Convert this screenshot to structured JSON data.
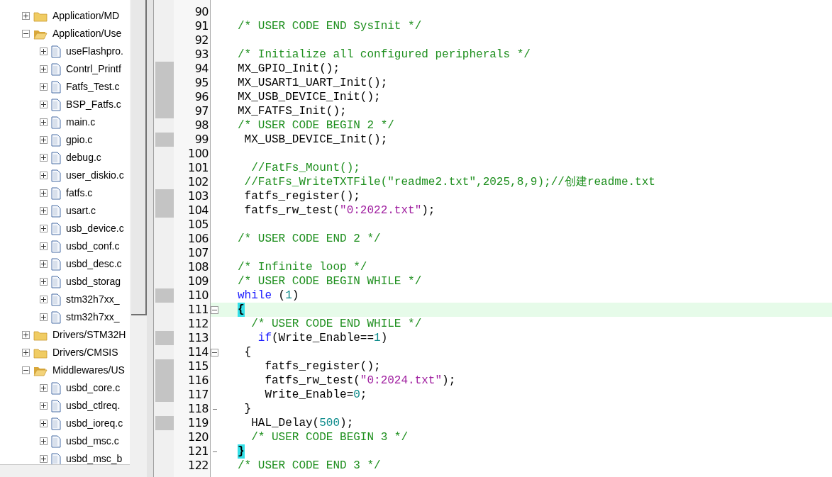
{
  "project_tree": [
    {
      "kind": "folder",
      "label": "Application/MD",
      "expanded": false
    },
    {
      "kind": "folder",
      "label": "Application/Use",
      "expanded": true,
      "children": [
        {
          "kind": "file",
          "label": "useFlashpro."
        },
        {
          "kind": "file",
          "label": "Contrl_Printf"
        },
        {
          "kind": "file",
          "label": "Fatfs_Test.c"
        },
        {
          "kind": "file",
          "label": "BSP_Fatfs.c"
        },
        {
          "kind": "file",
          "label": "main.c"
        },
        {
          "kind": "file",
          "label": "gpio.c"
        },
        {
          "kind": "file",
          "label": "debug.c"
        },
        {
          "kind": "file",
          "label": "user_diskio.c"
        },
        {
          "kind": "file",
          "label": "fatfs.c"
        },
        {
          "kind": "file",
          "label": "usart.c"
        },
        {
          "kind": "file",
          "label": "usb_device.c"
        },
        {
          "kind": "file",
          "label": "usbd_conf.c"
        },
        {
          "kind": "file",
          "label": "usbd_desc.c"
        },
        {
          "kind": "file",
          "label": "usbd_storag"
        },
        {
          "kind": "file",
          "label": "stm32h7xx_"
        },
        {
          "kind": "file",
          "label": "stm32h7xx_"
        }
      ]
    },
    {
      "kind": "folder",
      "label": "Drivers/STM32H",
      "expanded": false
    },
    {
      "kind": "folder",
      "label": "Drivers/CMSIS",
      "expanded": false
    },
    {
      "kind": "folder",
      "label": "Middlewares/US",
      "expanded": true,
      "children": [
        {
          "kind": "file",
          "label": "usbd_core.c"
        },
        {
          "kind": "file",
          "label": "usbd_ctlreq."
        },
        {
          "kind": "file",
          "label": "usbd_ioreq.c"
        },
        {
          "kind": "file",
          "label": "usbd_msc.c"
        },
        {
          "kind": "file",
          "label": "usbd_msc_b"
        }
      ]
    }
  ],
  "editor": {
    "lines": [
      {
        "number": "90",
        "marked": false,
        "current": false,
        "fold_open": false,
        "fold_end": false
      },
      {
        "number": "91",
        "marked": false,
        "current": false,
        "fold_open": false,
        "fold_end": false,
        "segments": [
          {
            "kind": "comment",
            "text": "/* USER CODE END SysInit */"
          }
        ]
      },
      {
        "number": "92",
        "marked": false,
        "current": false,
        "fold_open": false,
        "fold_end": false
      },
      {
        "number": "93",
        "marked": false,
        "current": false,
        "fold_open": false,
        "fold_end": false,
        "segments": [
          {
            "kind": "comment",
            "text": "/* Initialize all configured peripherals */"
          }
        ]
      },
      {
        "number": "94",
        "marked": true,
        "current": false,
        "fold_open": false,
        "fold_end": false,
        "segments": [
          {
            "kind": "plain",
            "text": "MX_GPIO_Init();"
          }
        ]
      },
      {
        "number": "95",
        "marked": true,
        "current": false,
        "fold_open": false,
        "fold_end": false,
        "segments": [
          {
            "kind": "plain",
            "text": "MX_USART1_UART_Init();"
          }
        ]
      },
      {
        "number": "96",
        "marked": true,
        "current": false,
        "fold_open": false,
        "fold_end": false,
        "segments": [
          {
            "kind": "plain",
            "text": "MX_USB_DEVICE_Init();"
          }
        ]
      },
      {
        "number": "97",
        "marked": true,
        "current": false,
        "fold_open": false,
        "fold_end": false,
        "segments": [
          {
            "kind": "plain",
            "text": "MX_FATFS_Init();"
          }
        ]
      },
      {
        "number": "98",
        "marked": false,
        "current": false,
        "fold_open": false,
        "fold_end": false,
        "segments": [
          {
            "kind": "comment",
            "text": "/* USER CODE BEGIN 2 */"
          }
        ]
      },
      {
        "number": "99",
        "marked": true,
        "current": false,
        "fold_open": false,
        "fold_end": false,
        "segments": [
          {
            "kind": "plain",
            "text": " MX_USB_DEVICE_Init();"
          }
        ]
      },
      {
        "number": "100",
        "marked": false,
        "current": false,
        "fold_open": false,
        "fold_end": false
      },
      {
        "number": "101",
        "marked": false,
        "current": false,
        "fold_open": false,
        "fold_end": false,
        "segments": [
          {
            "kind": "comment",
            "text": "  //FatFs_Mount();"
          }
        ]
      },
      {
        "number": "102",
        "marked": false,
        "current": false,
        "fold_open": false,
        "fold_end": false,
        "segments": [
          {
            "kind": "comment",
            "text": " //FatFs_WriteTXTFile(\"readme2.txt\",2025,8,9);//创建readme.txt"
          }
        ]
      },
      {
        "number": "103",
        "marked": true,
        "current": false,
        "fold_open": false,
        "fold_end": false,
        "segments": [
          {
            "kind": "plain",
            "text": " fatfs_register();"
          }
        ]
      },
      {
        "number": "104",
        "marked": true,
        "current": false,
        "fold_open": false,
        "fold_end": false,
        "segments": [
          {
            "kind": "plain",
            "text": " fatfs_rw_test("
          },
          {
            "kind": "string",
            "text": "\"0:2022.txt\""
          },
          {
            "kind": "plain",
            "text": ");"
          }
        ]
      },
      {
        "number": "105",
        "marked": false,
        "current": false,
        "fold_open": false,
        "fold_end": false
      },
      {
        "number": "106",
        "marked": false,
        "current": false,
        "fold_open": false,
        "fold_end": false,
        "segments": [
          {
            "kind": "comment",
            "text": "/* USER CODE END 2 */"
          }
        ]
      },
      {
        "number": "107",
        "marked": false,
        "current": false,
        "fold_open": false,
        "fold_end": false
      },
      {
        "number": "108",
        "marked": false,
        "current": false,
        "fold_open": false,
        "fold_end": false,
        "segments": [
          {
            "kind": "comment",
            "text": "/* Infinite loop */"
          }
        ]
      },
      {
        "number": "109",
        "marked": false,
        "current": false,
        "fold_open": false,
        "fold_end": false,
        "segments": [
          {
            "kind": "comment",
            "text": "/* USER CODE BEGIN WHILE */"
          }
        ]
      },
      {
        "number": "110",
        "marked": true,
        "current": false,
        "fold_open": false,
        "fold_end": false,
        "segments": [
          {
            "kind": "keyword",
            "text": "while"
          },
          {
            "kind": "plain",
            "text": " ("
          },
          {
            "kind": "number",
            "text": "1"
          },
          {
            "kind": "plain",
            "text": ")"
          }
        ]
      },
      {
        "number": "111",
        "marked": false,
        "current": true,
        "fold_open": true,
        "fold_end": false,
        "segments": [
          {
            "kind": "brace_match",
            "text": "{"
          }
        ]
      },
      {
        "number": "112",
        "marked": false,
        "current": false,
        "fold_open": false,
        "fold_end": false,
        "segments": [
          {
            "kind": "comment",
            "text": "  /* USER CODE END WHILE */"
          }
        ]
      },
      {
        "number": "113",
        "marked": true,
        "current": false,
        "fold_open": false,
        "fold_end": false,
        "segments": [
          {
            "kind": "keyword",
            "text": "   if"
          },
          {
            "kind": "plain",
            "text": "(Write_Enable=="
          },
          {
            "kind": "number",
            "text": "1"
          },
          {
            "kind": "plain",
            "text": ")"
          }
        ]
      },
      {
        "number": "114",
        "marked": false,
        "current": false,
        "fold_open": true,
        "fold_end": false,
        "segments": [
          {
            "kind": "plain",
            "text": " {"
          }
        ]
      },
      {
        "number": "115",
        "marked": true,
        "current": false,
        "fold_open": false,
        "fold_end": false,
        "segments": [
          {
            "kind": "plain",
            "text": "    fatfs_register();"
          }
        ]
      },
      {
        "number": "116",
        "marked": true,
        "current": false,
        "fold_open": false,
        "fold_end": false,
        "segments": [
          {
            "kind": "plain",
            "text": "    fatfs_rw_test("
          },
          {
            "kind": "string",
            "text": "\"0:2024.txt\""
          },
          {
            "kind": "plain",
            "text": ");"
          }
        ]
      },
      {
        "number": "117",
        "marked": true,
        "current": false,
        "fold_open": false,
        "fold_end": false,
        "segments": [
          {
            "kind": "plain",
            "text": "    Write_Enable="
          },
          {
            "kind": "number",
            "text": "0"
          },
          {
            "kind": "plain",
            "text": ";"
          }
        ]
      },
      {
        "number": "118",
        "marked": false,
        "current": false,
        "fold_open": false,
        "fold_end": true,
        "segments": [
          {
            "kind": "plain",
            "text": " }"
          }
        ]
      },
      {
        "number": "119",
        "marked": true,
        "current": false,
        "fold_open": false,
        "fold_end": false,
        "segments": [
          {
            "kind": "plain",
            "text": "  HAL_Delay("
          },
          {
            "kind": "number",
            "text": "500"
          },
          {
            "kind": "plain",
            "text": ");"
          }
        ]
      },
      {
        "number": "120",
        "marked": false,
        "current": false,
        "fold_open": false,
        "fold_end": false,
        "segments": [
          {
            "kind": "comment",
            "text": "  /* USER CODE BEGIN 3 */"
          }
        ]
      },
      {
        "number": "121",
        "marked": false,
        "current": false,
        "fold_open": false,
        "fold_end": true,
        "segments": [
          {
            "kind": "brace_match",
            "text": "}"
          }
        ]
      },
      {
        "number": "122",
        "marked": false,
        "current": false,
        "fold_open": false,
        "fold_end": false,
        "segments": [
          {
            "kind": "comment",
            "text": "/* USER CODE END 3 */"
          }
        ]
      }
    ]
  }
}
